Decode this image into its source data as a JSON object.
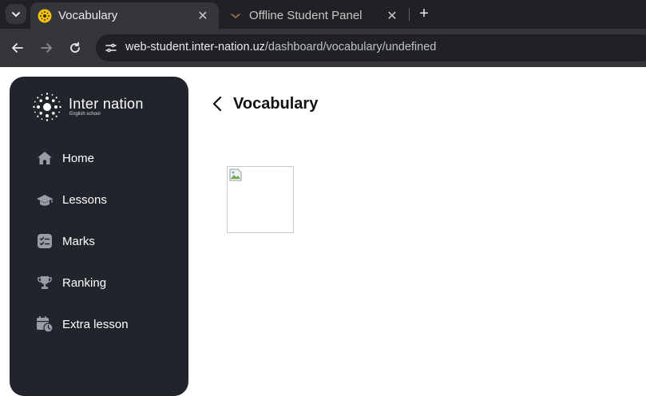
{
  "browser": {
    "tabs": [
      {
        "title": "Vocabulary",
        "active": true,
        "favicon": "inter-nation-favicon"
      },
      {
        "title": "Offline Student Panel",
        "active": false,
        "favicon": "bird-favicon"
      }
    ],
    "url_host": "web-student.inter-nation.uz",
    "url_path": "/dashboard/vocabulary/undefined"
  },
  "sidebar": {
    "logo_name": "Inter nation",
    "logo_sub": "English school",
    "items": [
      {
        "label": "Home",
        "icon": "home-icon"
      },
      {
        "label": "Lessons",
        "icon": "graduation-cap-icon"
      },
      {
        "label": "Marks",
        "icon": "checklist-icon"
      },
      {
        "label": "Ranking",
        "icon": "trophy-icon"
      },
      {
        "label": "Extra lesson",
        "icon": "calendar-clock-icon"
      }
    ]
  },
  "main": {
    "title": "Vocabulary"
  },
  "colors": {
    "sidebar_bg": "#22242c",
    "icon_gray": "#9a9ca3",
    "chrome_dark": "#202124",
    "chrome_tab": "#35363a"
  }
}
